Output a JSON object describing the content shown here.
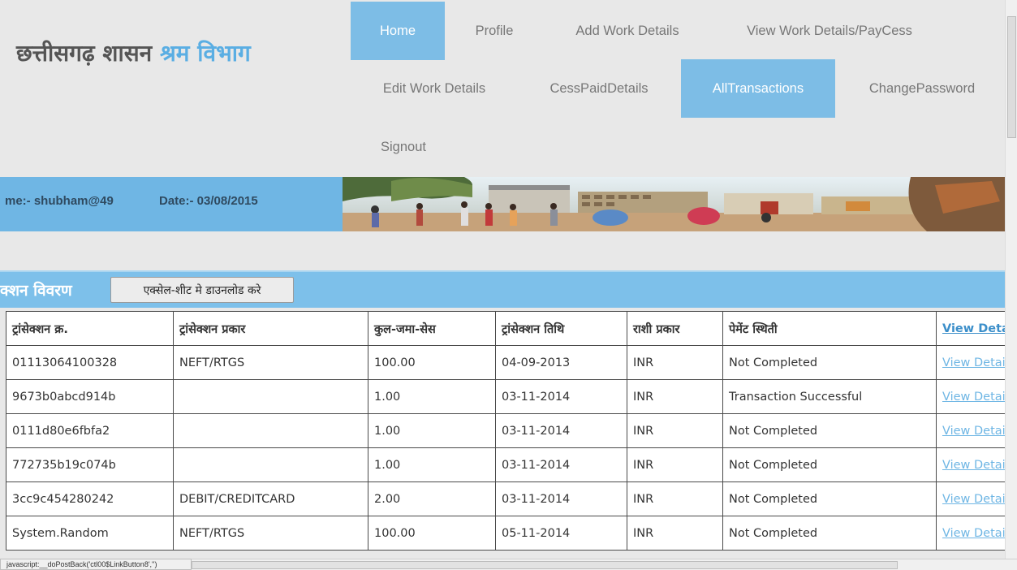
{
  "brand": {
    "part1": "छत्तीसगढ़ शासन",
    "part2": "श्रम विभाग"
  },
  "nav": {
    "home": "Home",
    "profile": "Profile",
    "add_work": "Add Work Details",
    "view_work": "View Work Details/PayCess",
    "edit_work": "Edit Work Details",
    "cess_paid": "CessPaidDetails",
    "all_transactions": "AllTransactions",
    "change_password": "ChangePassword",
    "signout": "Signout"
  },
  "info": {
    "username": "me:- shubham@49",
    "date": "Date:- 03/08/2015"
  },
  "section": {
    "title": "क्शन विवरण",
    "excel_button": "एक्सेल-शीट मे डाउनलोड करे"
  },
  "table": {
    "headers": [
      "ट्रांसेक्शन क्र.",
      "ट्रांसेक्शन प्रकार",
      "कुल-जमा-सेस",
      "ट्रांसेक्शन तिथि",
      "राशी प्रकार",
      "पेमेंट स्थिती",
      "View Deta"
    ],
    "rows": [
      [
        "01113064100328",
        "NEFT/RTGS",
        "100.00",
        "04-09-2013",
        "INR",
        "Not Completed",
        "View Detai"
      ],
      [
        "9673b0abcd914b",
        "",
        "1.00",
        "03-11-2014",
        "INR",
        "Transaction Successful",
        "View Detai"
      ],
      [
        "0111d80e6fbfa2",
        "",
        "1.00",
        "03-11-2014",
        "INR",
        "Not Completed",
        "View Detai"
      ],
      [
        "772735b19c074b",
        "",
        "1.00",
        "03-11-2014",
        "INR",
        "Not Completed",
        "View Detai"
      ],
      [
        "3cc9c454280242",
        "DEBIT/CREDITCARD",
        "2.00",
        "03-11-2014",
        "INR",
        "Not Completed",
        "View Detai"
      ],
      [
        "System.Random",
        "NEFT/RTGS",
        "100.00",
        "05-11-2014",
        "INR",
        "Not Completed",
        "View Detai"
      ]
    ]
  },
  "statusbar": {
    "text": "javascript:__doPostBack('ctl00$LinkButton8','')"
  },
  "colors": {
    "accent": "#7dbde6",
    "section": "#7dc0ea",
    "infobar": "#6fb6e4",
    "link": "#6fb6e4"
  }
}
